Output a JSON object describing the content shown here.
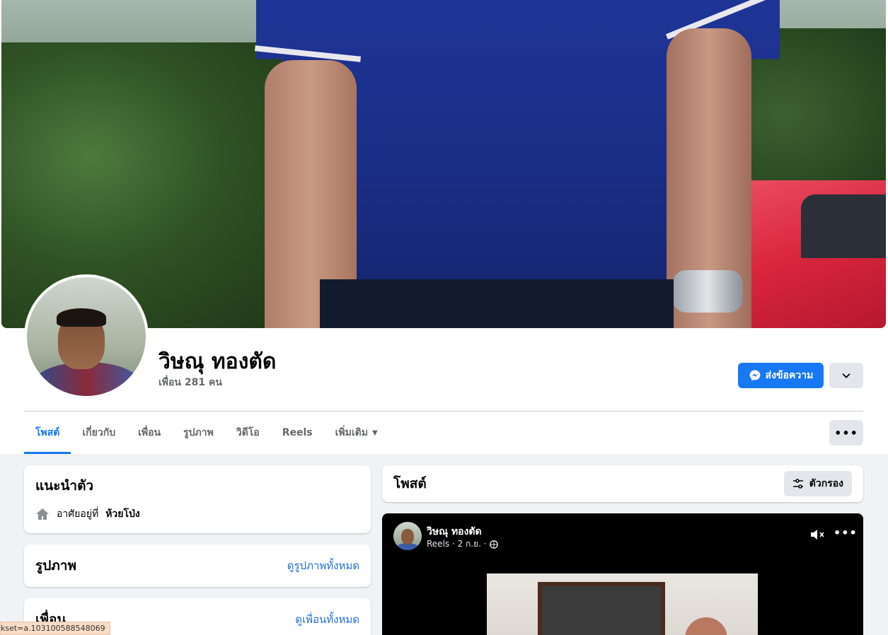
{
  "profile": {
    "name": "วิษณุ ทองตัด",
    "friends_count": "เพื่อน 281 คน"
  },
  "actions": {
    "message_label": "ส่งข้อความ"
  },
  "tabs": [
    {
      "label": "โพสต์",
      "active": true
    },
    {
      "label": "เกี่ยวกับ"
    },
    {
      "label": "เพื่อน"
    },
    {
      "label": "รูปภาพ"
    },
    {
      "label": "วิดีโอ"
    },
    {
      "label": "Reels"
    },
    {
      "label": "เพิ่มเติม"
    }
  ],
  "intro": {
    "title": "แนะนำตัว",
    "lives_prefix": "อาศัยอยู่ที่",
    "lives_place": "ห้วยโป่ง"
  },
  "photos": {
    "title": "รูปภาพ",
    "see_all": "ดูรูปภาพทั้งหมด"
  },
  "friends": {
    "title": "เพื่อน",
    "see_all": "ดูเพื่อนทั้งหมด"
  },
  "posts": {
    "title": "โพสต์",
    "filter_label": "ตัวกรอง"
  },
  "reel_post": {
    "author": "วิษณุ ทองตัด",
    "meta": "Reels · 2 ก.ย. ·"
  },
  "status_bar": {
    "url": "kset=a.103100588548069"
  },
  "colors": {
    "accent": "#1877f2",
    "link": "#216fdb",
    "background": "#f0f2f5"
  }
}
